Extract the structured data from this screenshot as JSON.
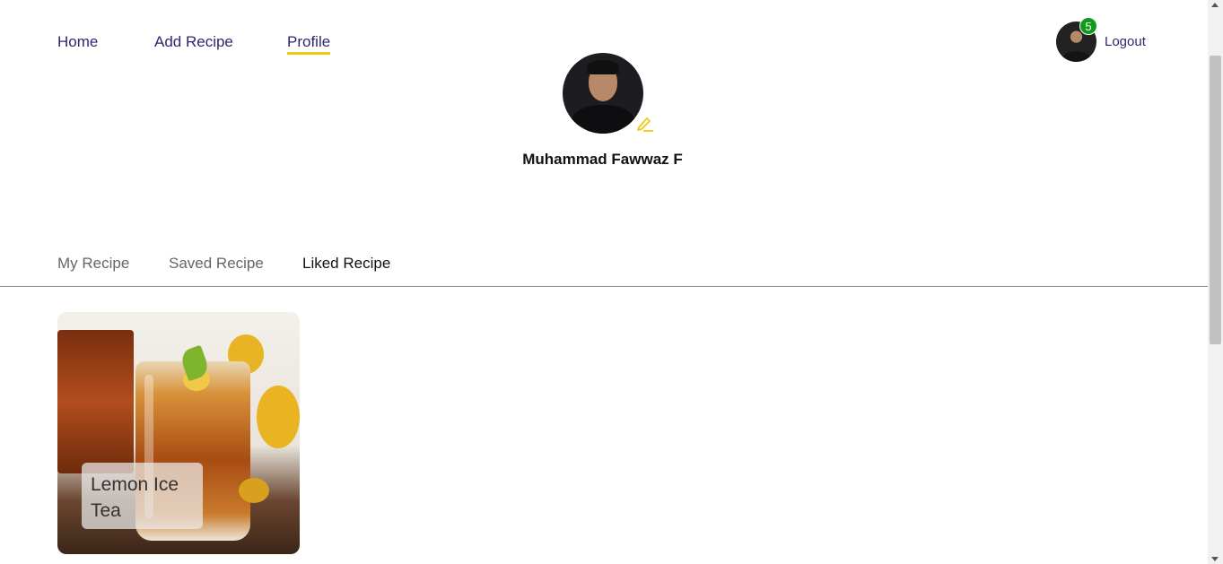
{
  "nav": {
    "home": "Home",
    "add_recipe": "Add Recipe",
    "profile": "Profile",
    "notification_count": "5",
    "logout": "Logout"
  },
  "profile": {
    "name": "Muhammad Fawwaz F"
  },
  "tabs": {
    "my_recipe": "My Recipe",
    "saved_recipe": "Saved Recipe",
    "liked_recipe": "Liked Recipe",
    "active": "Liked Recipe"
  },
  "recipes": [
    {
      "title": "Lemon Ice Tea"
    }
  ],
  "colors": {
    "nav_text": "#2e266f",
    "active_underline": "#efc81a",
    "badge": "#119a1c",
    "edit_icon": "#efc81a"
  },
  "icons": {
    "edit": "pencil-icon",
    "user": "avatar"
  }
}
